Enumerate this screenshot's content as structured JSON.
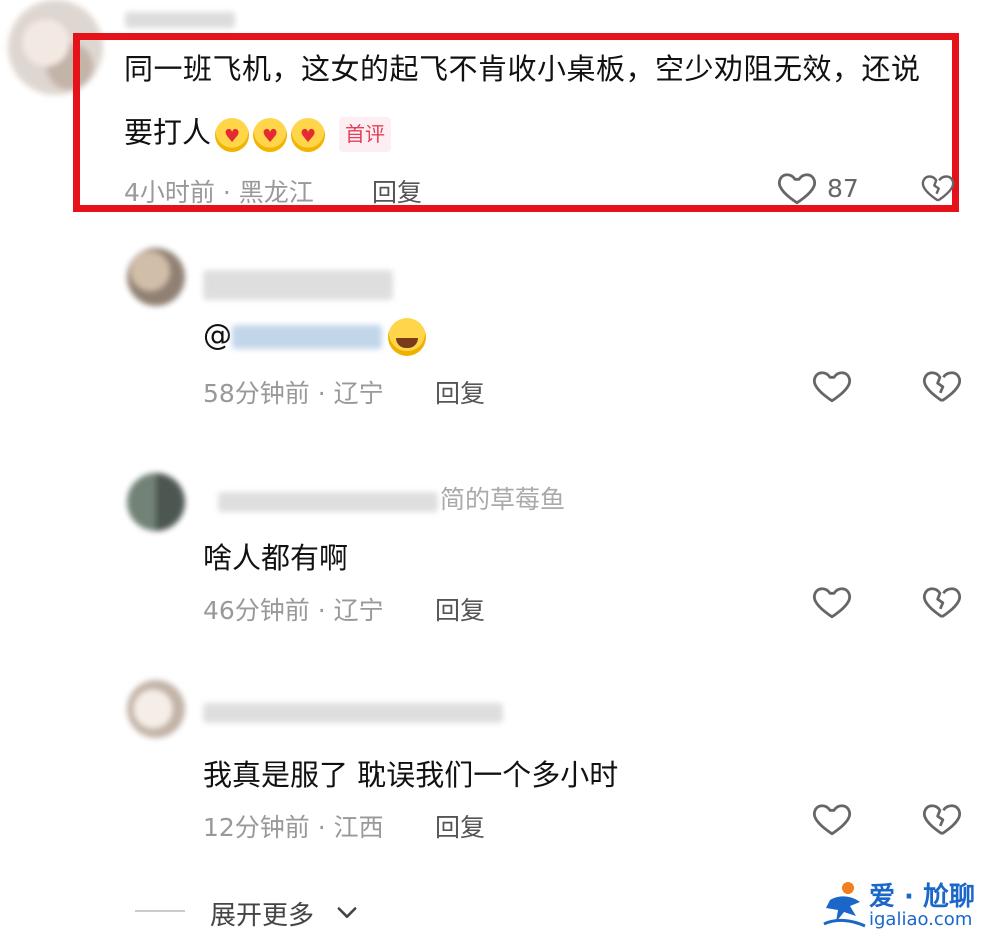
{
  "top_comment": {
    "text_line1": "同一班飞机，这女的起飞不肯收小桌板，空少劝阻无效，还说",
    "text_line2": "要打人",
    "badge": "首评",
    "time": "4小时前 · 黑龙江",
    "reply_label": "回复",
    "like_count": "87",
    "emoji_count": 3
  },
  "replies": [
    {
      "text": "",
      "time": "58分钟前 · 辽宁",
      "reply_label": "回复"
    },
    {
      "partial_name": "简的草莓鱼",
      "text": "啥人都有啊",
      "time": "46分钟前 · 辽宁",
      "reply_label": "回复"
    },
    {
      "text": "我真是服了 耽误我们一个多小时",
      "time": "12分钟前 · 江西",
      "reply_label": "回复"
    }
  ],
  "mention_prefix": "@",
  "expand_label": "展开更多",
  "watermark": {
    "title": "爱 · 尬聊",
    "url": "igaliao.com"
  },
  "colors": {
    "highlight": "#e6121a",
    "badge_text": "#e0405a",
    "meta_text": "#999999",
    "watermark": "#1b67c9"
  },
  "icons": {
    "like": "heart-outline-icon",
    "dislike": "broken-heart-icon",
    "expand": "chevron-down-icon"
  }
}
